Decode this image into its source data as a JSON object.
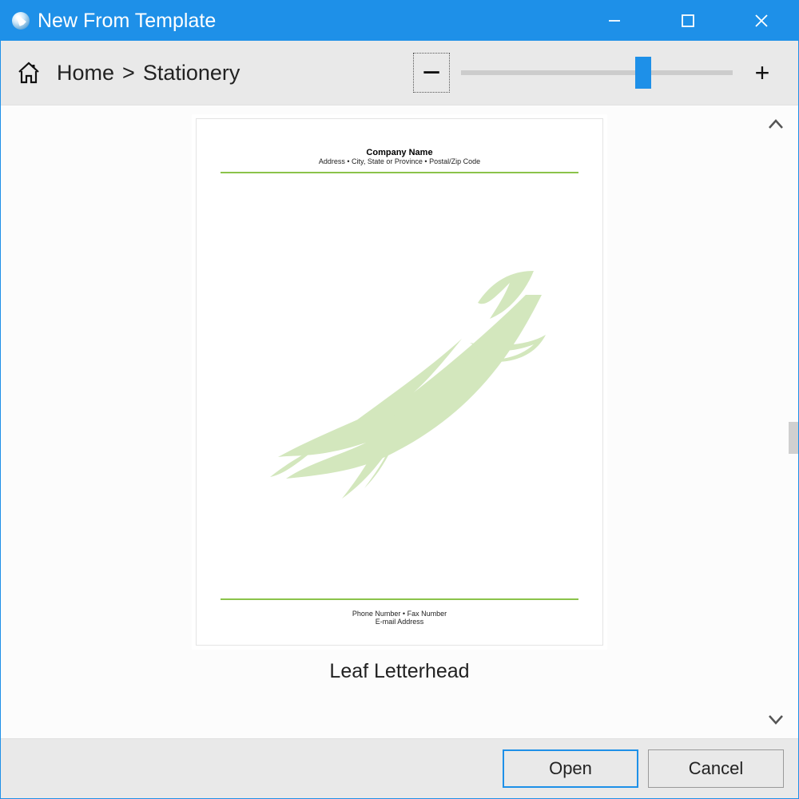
{
  "window": {
    "title": "New From Template"
  },
  "breadcrumb": {
    "home": "Home",
    "separator": ">",
    "current": "Stationery"
  },
  "zoom": {
    "minus_label": "−",
    "plus_label": "+",
    "value_percent": 68
  },
  "template": {
    "caption": "Leaf Letterhead",
    "preview": {
      "company": "Company Name",
      "address_line": "Address • City, State or Province • Postal/Zip Code",
      "footer_line1": "Phone Number • Fax Number",
      "footer_line2": "E-mail Address"
    }
  },
  "buttons": {
    "open": "Open",
    "cancel": "Cancel"
  },
  "colors": {
    "accent": "#1e90e8",
    "leaf": "#d3e7bd",
    "rule": "#8bc34a"
  }
}
